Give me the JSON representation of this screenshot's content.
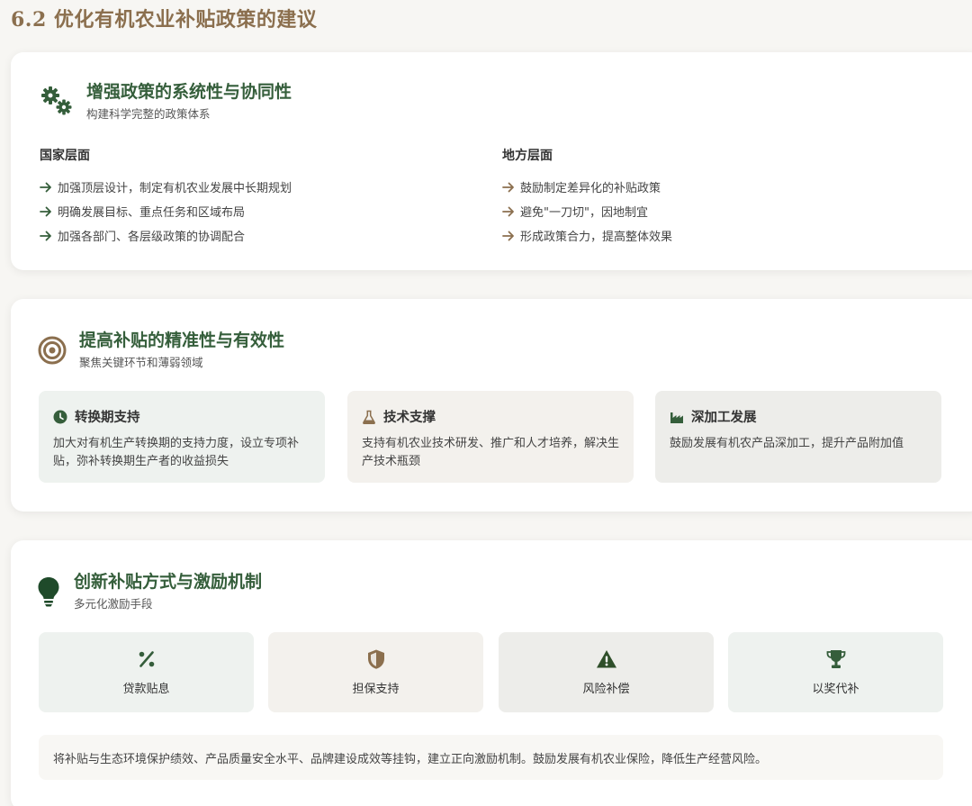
{
  "page": {
    "title": "6.2 优化有机农业补贴政策的建议"
  },
  "section1": {
    "title": "增强政策的系统性与协同性",
    "subtitle": "构建科学完整的政策体系",
    "icon": "gears-icon",
    "national": {
      "title": "国家层面",
      "items": [
        "加强顶层设计，制定有机农业发展中长期规划",
        "明确发展目标、重点任务和区域布局",
        "加强各部门、各层级政策的协调配合"
      ]
    },
    "local": {
      "title": "地方层面",
      "items": [
        "鼓励制定差异化的补贴政策",
        "避免\"一刀切\"，因地制宜",
        "形成政策合力，提高整体效果"
      ]
    }
  },
  "section2": {
    "title": "提高补贴的精准性与有效性",
    "subtitle": "聚焦关键环节和薄弱领域",
    "icon": "target-icon",
    "cards": [
      {
        "title": "转换期支持",
        "icon": "clock-icon",
        "desc": "加大对有机生产转换期的支持力度，设立专项补贴，弥补转换期生产者的收益损失"
      },
      {
        "title": "技术支撑",
        "icon": "flask-icon",
        "desc": "支持有机农业技术研发、推广和人才培养，解决生产技术瓶颈"
      },
      {
        "title": "深加工发展",
        "icon": "factory-icon",
        "desc": "鼓励发展有机农产品深加工，提升产品附加值"
      }
    ]
  },
  "section3": {
    "title": "创新补贴方式与激励机制",
    "subtitle": "多元化激励手段",
    "icon": "lightbulb-icon",
    "tiles": [
      {
        "label": "贷款贴息",
        "icon": "percent-icon"
      },
      {
        "label": "担保支持",
        "icon": "shield-icon"
      },
      {
        "label": "风险补偿",
        "icon": "warning-icon"
      },
      {
        "label": "以奖代补",
        "icon": "trophy-icon"
      }
    ],
    "note": "将补贴与生态环境保护绩效、产品质量安全水平、品牌建设成效等挂钩，建立正向激励机制。鼓励发展有机农业保险，降低生产经营风险。"
  },
  "colors": {
    "green": "#355e3b",
    "brown": "#8b6f4e",
    "background": "#f7f6f3"
  }
}
